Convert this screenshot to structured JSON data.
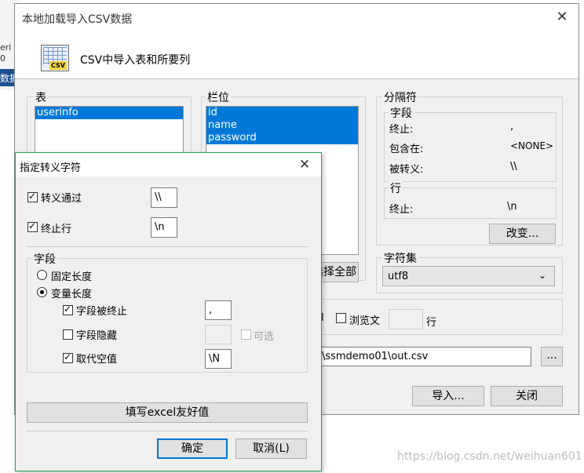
{
  "background_window": {
    "text_1": "eri",
    "text_2": "0",
    "bar_text": "数据"
  },
  "main_dialog": {
    "title": "本地加载导入CSV数据",
    "header_title": "CSV中导入表和所要列",
    "icon_tag": "CSV",
    "table_group": {
      "label": "表",
      "items": [
        "userinfo"
      ]
    },
    "columns_group": {
      "label": "栏位",
      "items": [
        "id",
        "name",
        "password"
      ],
      "select_all_fragment": "选择全部"
    },
    "delimiter_group": {
      "label": "分隔符",
      "field_sub": {
        "label": "字段",
        "terminated_label": "终止:",
        "terminated_value": ",",
        "enclosed_label": "包含在:",
        "enclosed_value": "<NONE>",
        "escaped_label": "被转义:",
        "escaped_value": "\\\\"
      },
      "line_sub": {
        "label": "行",
        "terminated_label": "终止:",
        "terminated_value": "\\n"
      },
      "change_button": "改变..."
    },
    "charset_group": {
      "label": "字符集",
      "value": "utf8"
    },
    "skip_row": {
      "prefix_fragment": "l",
      "label": "浏览文",
      "value": "",
      "suffix": "行"
    },
    "file_path": "o\\ssmdemo01\\out.csv",
    "browse_button": "...",
    "import_button": "导入...",
    "close_button": "关闭"
  },
  "escape_dialog": {
    "title": "指定转义字符",
    "escaped_by": {
      "label": "转义通过",
      "checked": true,
      "value": "\\\\"
    },
    "line_terminated": {
      "label": "终止行",
      "checked": true,
      "value": "\\n"
    },
    "field_group": {
      "label": "字段",
      "fixed_length": {
        "label": "固定长度",
        "selected": false
      },
      "variable_length": {
        "label": "变量长度",
        "selected": true
      },
      "terminated": {
        "label": "字段被终止",
        "checked": true,
        "value": ","
      },
      "enclosed": {
        "label": "字段隐藏",
        "checked": false,
        "value": "",
        "optional_label": "可选",
        "optional_checked": false
      },
      "replace_null": {
        "label": "取代空值",
        "checked": true,
        "value": "\\N"
      }
    },
    "excel_button": "填写excel友好值",
    "ok_button": "确定",
    "cancel_button": "取消(L)"
  },
  "watermark": "https://blog.csdn.net/weihuan601",
  "colors": {
    "selection": "#0078d7",
    "sub_border": "#1aa85c",
    "bar_blue": "#1b4f91"
  }
}
